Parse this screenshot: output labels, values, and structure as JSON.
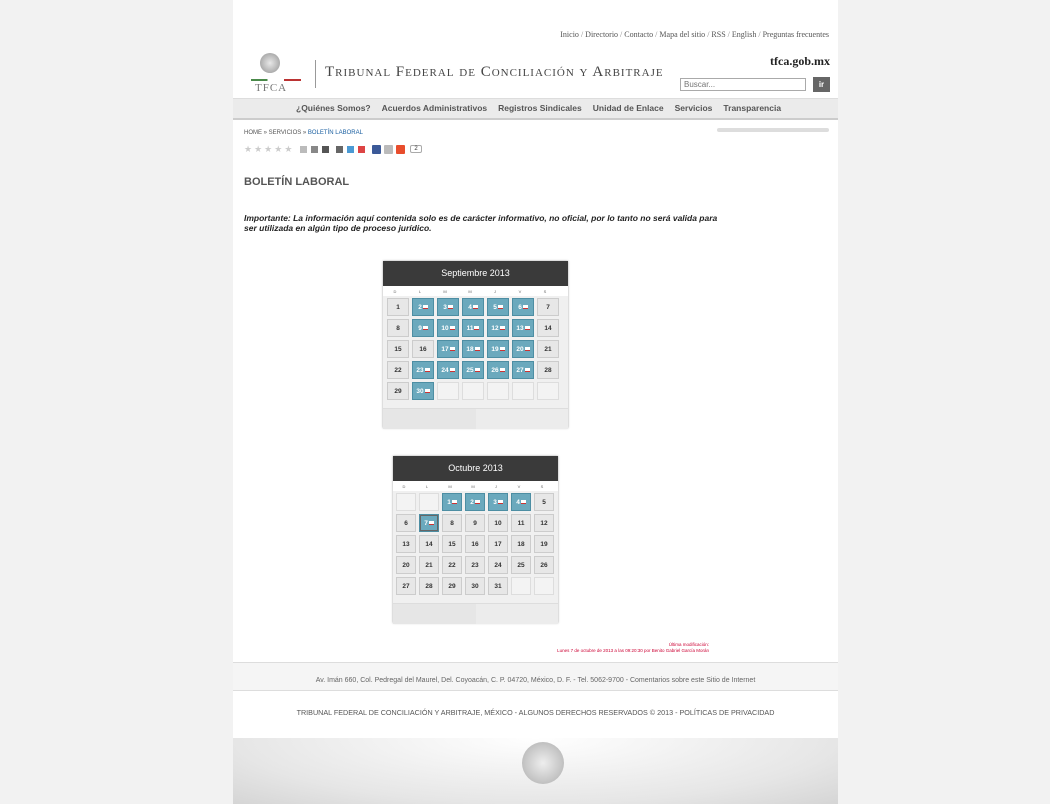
{
  "toplinks": [
    "Inicio",
    "Directorio",
    "Contacto",
    "Mapa del sitio",
    "RSS",
    "English",
    "Preguntas frecuentes"
  ],
  "header": {
    "logo_text": "TFCA",
    "title": "Tribunal Federal de Conciliación y Arbitraje",
    "domain": "tfca.gob.mx",
    "search_placeholder": "Buscar...",
    "search_button": "ir"
  },
  "nav": [
    "¿Quiénes Somos?",
    "Acuerdos Administrativos",
    "Registros Sindicales",
    "Unidad de Enlace",
    "Servicios",
    "Transparencia"
  ],
  "breadcrumb": {
    "home": "HOME",
    "sep": " » ",
    "servicios": "SERVICIOS",
    "current": "BOLETÍN LABORAL"
  },
  "share_count": "2",
  "page_title": "BOLETÍN LABORAL",
  "notice": "Importante: La información aquí contenida solo es de carácter informativo, no oficial, por lo tanto no será valida para ser utilizada en algún tipo de proceso jurídico.",
  "dow": [
    "D",
    "L",
    "M",
    "M",
    "J",
    "V",
    "S"
  ],
  "calendars": [
    {
      "title": "Septiembre 2013",
      "weeks": [
        [
          {
            "d": "1",
            "t": "n"
          },
          {
            "d": "2",
            "t": "h"
          },
          {
            "d": "3",
            "t": "h"
          },
          {
            "d": "4",
            "t": "h"
          },
          {
            "d": "5",
            "t": "h"
          },
          {
            "d": "6",
            "t": "h"
          },
          {
            "d": "7",
            "t": "n"
          }
        ],
        [
          {
            "d": "8",
            "t": "n"
          },
          {
            "d": "9",
            "t": "h"
          },
          {
            "d": "10",
            "t": "h"
          },
          {
            "d": "11",
            "t": "h"
          },
          {
            "d": "12",
            "t": "h"
          },
          {
            "d": "13",
            "t": "h"
          },
          {
            "d": "14",
            "t": "n"
          }
        ],
        [
          {
            "d": "15",
            "t": "n"
          },
          {
            "d": "16",
            "t": "n"
          },
          {
            "d": "17",
            "t": "h"
          },
          {
            "d": "18",
            "t": "h"
          },
          {
            "d": "19",
            "t": "h"
          },
          {
            "d": "20",
            "t": "h"
          },
          {
            "d": "21",
            "t": "n"
          }
        ],
        [
          {
            "d": "22",
            "t": "n"
          },
          {
            "d": "23",
            "t": "h"
          },
          {
            "d": "24",
            "t": "h"
          },
          {
            "d": "25",
            "t": "h"
          },
          {
            "d": "26",
            "t": "h"
          },
          {
            "d": "27",
            "t": "h"
          },
          {
            "d": "28",
            "t": "n"
          }
        ],
        [
          {
            "d": "29",
            "t": "n"
          },
          {
            "d": "30",
            "t": "h"
          },
          {
            "d": "",
            "t": "e"
          },
          {
            "d": "",
            "t": "e"
          },
          {
            "d": "",
            "t": "e"
          },
          {
            "d": "",
            "t": "e"
          },
          {
            "d": "",
            "t": "e"
          }
        ]
      ]
    },
    {
      "title": "Octubre 2013",
      "weeks": [
        [
          {
            "d": "",
            "t": "e"
          },
          {
            "d": "",
            "t": "e"
          },
          {
            "d": "1",
            "t": "h"
          },
          {
            "d": "2",
            "t": "h"
          },
          {
            "d": "3",
            "t": "h"
          },
          {
            "d": "4",
            "t": "h"
          },
          {
            "d": "5",
            "t": "n"
          }
        ],
        [
          {
            "d": "6",
            "t": "n"
          },
          {
            "d": "7",
            "t": "h",
            "sel": true
          },
          {
            "d": "8",
            "t": "n"
          },
          {
            "d": "9",
            "t": "n"
          },
          {
            "d": "10",
            "t": "n"
          },
          {
            "d": "11",
            "t": "n"
          },
          {
            "d": "12",
            "t": "n"
          }
        ],
        [
          {
            "d": "13",
            "t": "n"
          },
          {
            "d": "14",
            "t": "n"
          },
          {
            "d": "15",
            "t": "n"
          },
          {
            "d": "16",
            "t": "n"
          },
          {
            "d": "17",
            "t": "n"
          },
          {
            "d": "18",
            "t": "n"
          },
          {
            "d": "19",
            "t": "n"
          }
        ],
        [
          {
            "d": "20",
            "t": "n"
          },
          {
            "d": "21",
            "t": "n"
          },
          {
            "d": "22",
            "t": "n"
          },
          {
            "d": "23",
            "t": "n"
          },
          {
            "d": "24",
            "t": "n"
          },
          {
            "d": "25",
            "t": "n"
          },
          {
            "d": "26",
            "t": "n"
          }
        ],
        [
          {
            "d": "27",
            "t": "n"
          },
          {
            "d": "28",
            "t": "n"
          },
          {
            "d": "29",
            "t": "n"
          },
          {
            "d": "30",
            "t": "n"
          },
          {
            "d": "31",
            "t": "n"
          },
          {
            "d": "",
            "t": "e"
          },
          {
            "d": "",
            "t": "e"
          }
        ]
      ]
    }
  ],
  "modified": {
    "label": "Última modificación:",
    "value": "Lunes 7 de octubre de 2013 a las 09:20:30 por Benito Gabriel García Morán"
  },
  "footer": {
    "address": "Av. Imán 660, Col. Pedregal del Maurel, Del. Coyoacán, C. P. 04720, México, D. F. - Tel. 5062-9700 - Comentarios sobre este Sitio de Internet",
    "rights": "TRIBUNAL FEDERAL DE CONCILIACIÓN Y ARBITRAJE, MÉXICO - ALGUNOS DERECHOS RESERVADOS © 2013 - POLÍTICAS DE PRIVACIDAD"
  },
  "colors": {
    "holiday": "#6ba9bd",
    "header_dark": "#3a3a3a",
    "link_blue": "#1a5fa0",
    "modified_red": "#c03"
  }
}
